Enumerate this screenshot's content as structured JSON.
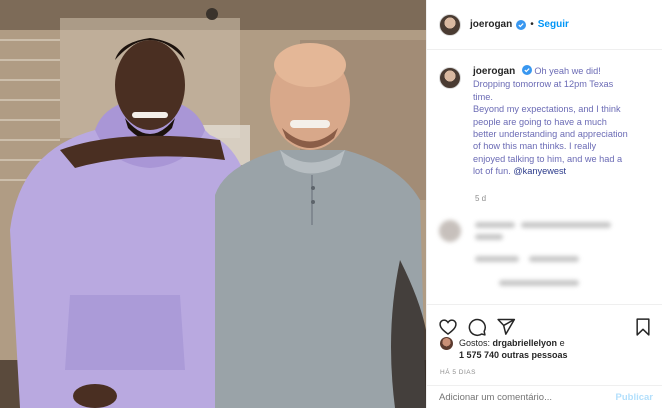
{
  "post": {
    "username": "joerogan",
    "follow_label": "Seguir",
    "separator": "•",
    "caption_lines": [
      "Oh yeah we did!",
      "Dropping tomorrow at 12pm Texas",
      "time.",
      "Beyond my expectations, and I think",
      "people are going to have a much",
      "better understanding and appreciation",
      "of how this man thinks. I really",
      "enjoyed talking to him, and we had a",
      "lot of fun."
    ],
    "mention": "@kanyewest",
    "caption_time": "5 d",
    "likes_prefix": "Gostos:",
    "likes_user": "drgabriellelyon",
    "likes_joiner": "e",
    "likes_count_text": "1 575 740 outras pessoas",
    "date_label": "HÁ 5 DIAS",
    "comment_placeholder": "Adicionar um comentário...",
    "publish_label": "Publicar"
  },
  "icons": {
    "verified": "verified-badge-icon",
    "like": "heart-icon",
    "comment": "comment-icon",
    "share": "paper-plane-icon",
    "save": "bookmark-icon"
  },
  "colors": {
    "accent": "#0095f6",
    "verified": "#3897f0",
    "secondary_text": "#8e8e8e"
  }
}
